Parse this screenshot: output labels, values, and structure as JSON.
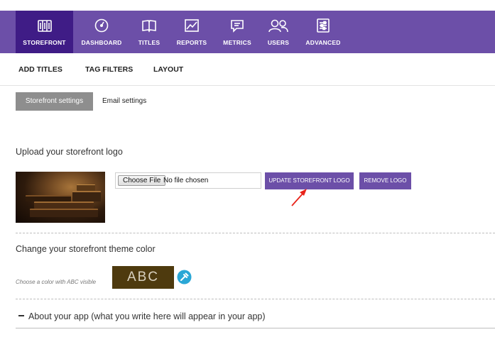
{
  "topnav": {
    "items": [
      {
        "label": "STOREFRONT",
        "icon": "storefront-icon",
        "active": true
      },
      {
        "label": "DASHBOARD",
        "icon": "gauge-icon",
        "active": false
      },
      {
        "label": "TITLES",
        "icon": "book-icon",
        "active": false
      },
      {
        "label": "REPORTS",
        "icon": "chart-icon",
        "active": false
      },
      {
        "label": "METRICS",
        "icon": "message-icon",
        "active": false
      },
      {
        "label": "USERS",
        "icon": "users-icon",
        "active": false
      },
      {
        "label": "ADVANCED",
        "icon": "sliders-icon",
        "active": false
      }
    ]
  },
  "subnav": {
    "items": [
      "ADD TITLES",
      "TAG FILTERS",
      "LAYOUT"
    ]
  },
  "settings_tabs": {
    "active": "Storefront settings",
    "other": "Email settings"
  },
  "logo_section": {
    "title": "Upload your storefront logo",
    "choose_file_label": "Choose File",
    "file_status": "No file chosen",
    "update_button": "UPDATE STOREFRONT LOGO",
    "remove_button": "REMOVE LOGO"
  },
  "theme_section": {
    "title": "Change your storefront theme color",
    "hint": "Choose a color with ABC visible",
    "swatch_text": "ABC",
    "swatch_color": "#4e3a0e"
  },
  "about_section": {
    "title": "About your app (what you write here will appear in your app)"
  },
  "colors": {
    "nav_background": "#6c4fa8",
    "nav_active": "#3f1c86",
    "button_purple": "#6c4fa8",
    "tab_active": "#8e8e8e",
    "picker_blue": "#2aa7d6",
    "annotation_red": "#e8231a"
  }
}
